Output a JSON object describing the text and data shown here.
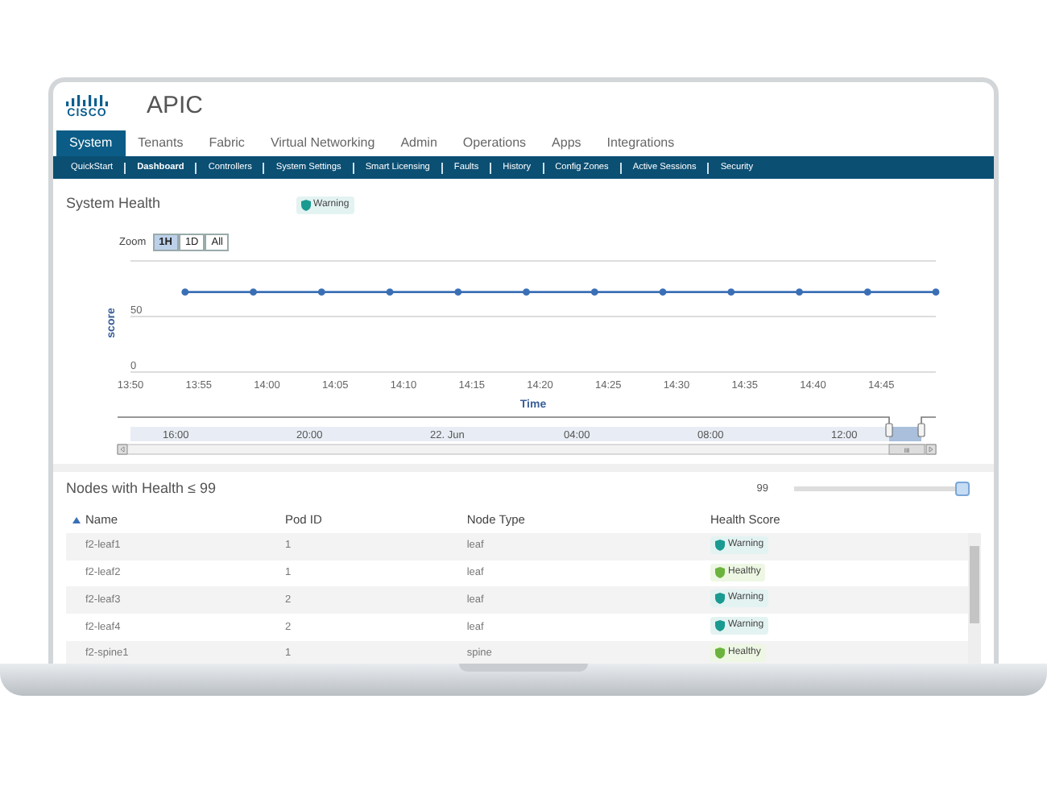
{
  "app": {
    "logo_text": "CISCO",
    "title": "APIC"
  },
  "tabs": [
    {
      "label": "System",
      "selected": true
    },
    {
      "label": "Tenants",
      "selected": false
    },
    {
      "label": "Fabric",
      "selected": false
    },
    {
      "label": "Virtual Networking",
      "selected": false
    },
    {
      "label": "Admin",
      "selected": false
    },
    {
      "label": "Operations",
      "selected": false
    },
    {
      "label": "Apps",
      "selected": false
    },
    {
      "label": "Integrations",
      "selected": false
    }
  ],
  "subnav": [
    {
      "label": "QuickStart",
      "selected": false
    },
    {
      "label": "Dashboard",
      "selected": true
    },
    {
      "label": "Controllers",
      "selected": false
    },
    {
      "label": "System Settings",
      "selected": false
    },
    {
      "label": "Smart Licensing",
      "selected": false
    },
    {
      "label": "Faults",
      "selected": false
    },
    {
      "label": "History",
      "selected": false
    },
    {
      "label": "Config Zones",
      "selected": false
    },
    {
      "label": "Active Sessions",
      "selected": false
    },
    {
      "label": "Security",
      "selected": false
    }
  ],
  "system_health": {
    "title": "System Health",
    "status": {
      "label": "Warning",
      "kind": "warning"
    },
    "zoom_label": "Zoom",
    "zoom_buttons": [
      {
        "label": "1H",
        "selected": true
      },
      {
        "label": "1D",
        "selected": false
      },
      {
        "label": "All",
        "selected": false
      }
    ],
    "chart_data": {
      "type": "line",
      "xlabel": "Time",
      "ylabel": "score",
      "x": [
        834,
        839,
        844,
        849,
        854,
        859,
        864,
        869,
        874,
        879,
        884,
        889
      ],
      "series": [
        {
          "color": "#3a6fb5",
          "marker": "circle",
          "values": [
            72,
            72,
            72,
            72,
            72,
            72,
            72,
            72,
            72,
            72,
            72,
            72
          ]
        }
      ],
      "xlim": [
        830,
        889
      ],
      "ylim": [
        0,
        100
      ],
      "yticks": [
        0,
        50
      ],
      "xticks": [
        {
          "value": 830,
          "label": "13:50"
        },
        {
          "value": 835,
          "label": "13:55"
        },
        {
          "value": 840,
          "label": "14:00"
        },
        {
          "value": 845,
          "label": "14:05"
        },
        {
          "value": 850,
          "label": "14:10"
        },
        {
          "value": 855,
          "label": "14:15"
        },
        {
          "value": 860,
          "label": "14:20"
        },
        {
          "value": 865,
          "label": "14:25"
        },
        {
          "value": 870,
          "label": "14:30"
        },
        {
          "value": 875,
          "label": "14:35"
        },
        {
          "value": 880,
          "label": "14:40"
        },
        {
          "value": 885,
          "label": "14:45"
        }
      ]
    },
    "navigator": {
      "labels": [
        "16:00",
        "20:00",
        "22. Jun",
        "04:00",
        "08:00",
        "12:00"
      ],
      "scroll_grip": "III"
    }
  },
  "nodes": {
    "title": "Nodes with Health ≤ 99",
    "threshold": {
      "reading": "99",
      "level": 1
    },
    "columns": [
      {
        "label": "Name",
        "sorted": true
      },
      {
        "label": "Pod ID",
        "sorted": false
      },
      {
        "label": "Node Type",
        "sorted": false
      },
      {
        "label": "Health Score",
        "sorted": false
      }
    ],
    "rows": [
      {
        "name": "f2-leaf1",
        "pod_id": "1",
        "node_type": "leaf",
        "health": {
          "label": "Warning",
          "kind": "warning"
        }
      },
      {
        "name": "f2-leaf2",
        "pod_id": "1",
        "node_type": "leaf",
        "health": {
          "label": "Healthy",
          "kind": "healthy"
        }
      },
      {
        "name": "f2-leaf3",
        "pod_id": "2",
        "node_type": "leaf",
        "health": {
          "label": "Warning",
          "kind": "warning"
        }
      },
      {
        "name": "f2-leaf4",
        "pod_id": "2",
        "node_type": "leaf",
        "health": {
          "label": "Warning",
          "kind": "warning"
        }
      },
      {
        "name": "f2-spine1",
        "pod_id": "1",
        "node_type": "spine",
        "health": {
          "label": "Healthy",
          "kind": "healthy"
        }
      }
    ]
  }
}
